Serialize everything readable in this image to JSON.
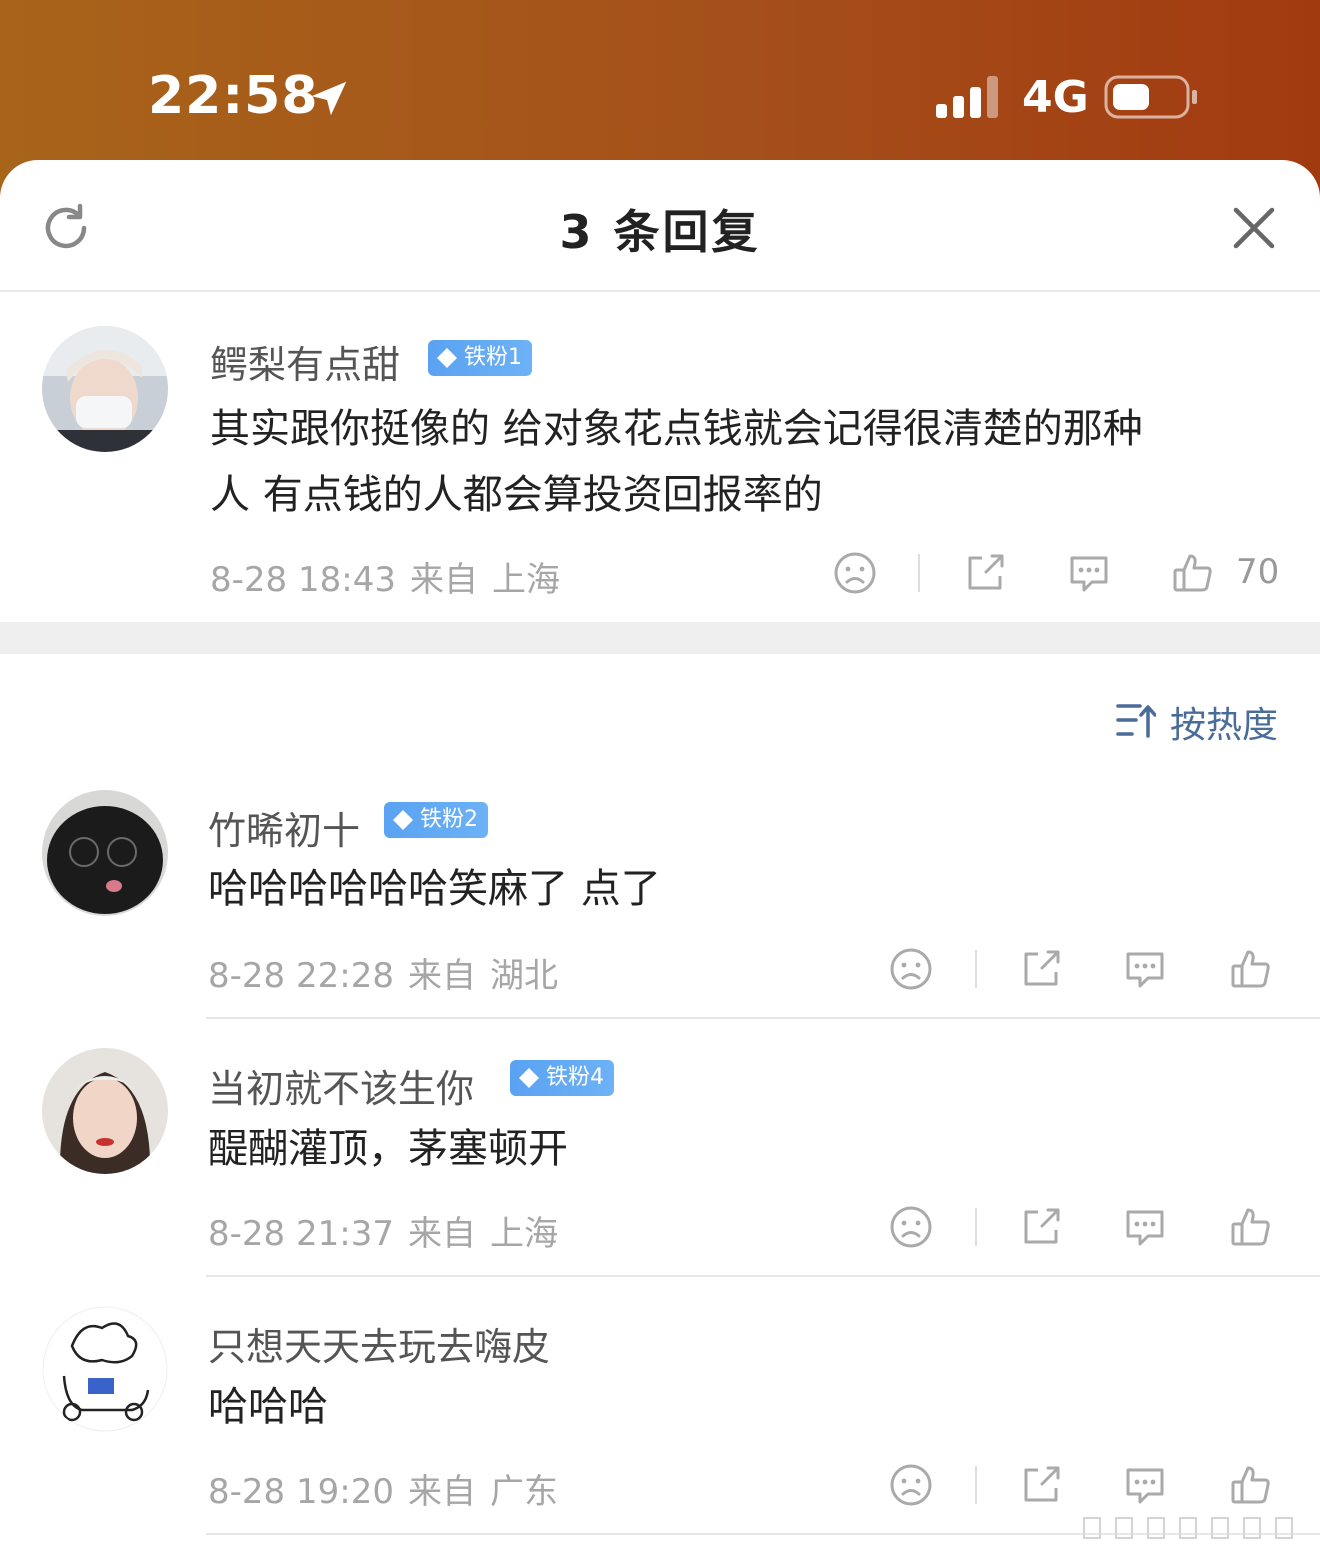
{
  "status_bar": {
    "time": "22:58",
    "network": "4G"
  },
  "header": {
    "title": "3 条回复"
  },
  "root_comment": {
    "user": "鳄梨有点甜",
    "badge": "铁粉1",
    "text_line1": "其实跟你挺像的 给对象花点钱就会记得很清楚的那种",
    "text_line2": "人 有点钱的人都会算投资回报率的",
    "time": "8-28 18:43",
    "from_label": "来自",
    "location": "上海",
    "likes": "70"
  },
  "sort": {
    "label": "按热度"
  },
  "replies": [
    {
      "user": "竹晞初十",
      "badge": "铁粉2",
      "text": "哈哈哈哈哈哈笑麻了 点了",
      "time": "8-28 22:28",
      "from_label": "来自",
      "location": "湖北"
    },
    {
      "user": "当初就不该生你",
      "badge": "铁粉4",
      "text": "醍醐灌顶，茅塞顿开",
      "time": "8-28 21:37",
      "from_label": "来自",
      "location": "上海"
    },
    {
      "user": "只想天天去玩去嗨皮",
      "badge": "",
      "text": "哈哈哈",
      "time": "8-28 19:20",
      "from_label": "来自",
      "location": "广东"
    }
  ],
  "icons": {
    "location": "location-arrow-icon",
    "signal": "cellular-signal-icon",
    "battery": "battery-icon",
    "refresh": "refresh-icon",
    "close": "close-icon",
    "dislike": "sad-face-icon",
    "share": "share-icon",
    "reply": "comment-icon",
    "like": "thumbs-up-icon",
    "sort": "sort-icon",
    "badge": "diamond-icon"
  },
  "colors": {
    "status_bar_start": "#a8641a",
    "status_bar_end": "#a23a10",
    "badge": "#5aa2f2",
    "sort_text": "#4a6c99",
    "meta_text": "#a6a6a6"
  }
}
